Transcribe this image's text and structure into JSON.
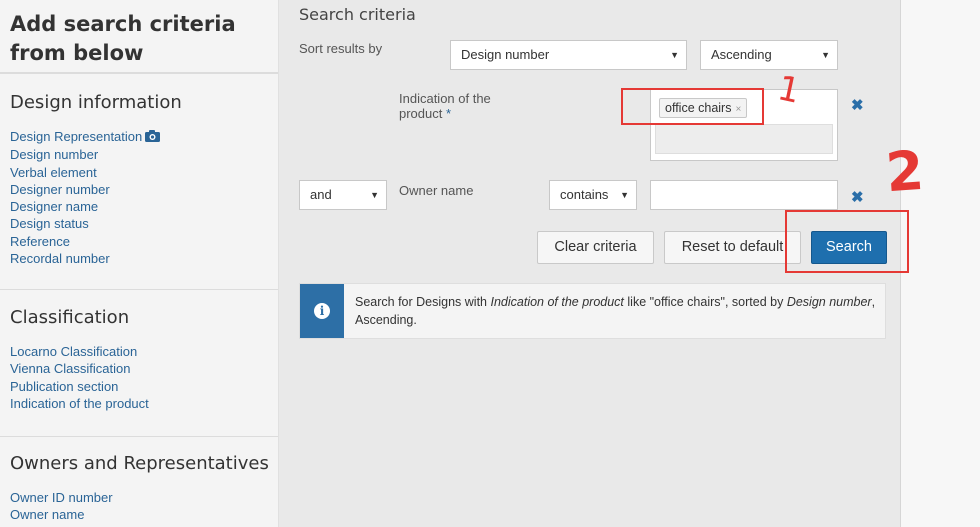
{
  "sidebar": {
    "title": "Add search criteria from below",
    "sections": [
      {
        "heading": "Design information",
        "links": [
          "Design Representation",
          "Design number",
          "Verbal element",
          "Designer number",
          "Designer name",
          "Design status",
          "Reference",
          "Recordal number"
        ]
      },
      {
        "heading": "Classification",
        "links": [
          "Locarno Classification",
          "Vienna Classification",
          "Publication section",
          "Indication of the product"
        ]
      },
      {
        "heading": "Owners and Representatives",
        "links": [
          "Owner ID number",
          "Owner name"
        ]
      }
    ]
  },
  "main": {
    "heading": "Search criteria",
    "sort_label": "Sort results by",
    "sort_field": "Design number",
    "sort_order": "Ascending",
    "criterion1": {
      "label": "Indication of the product",
      "required_mark": "*",
      "tag": "office chairs",
      "tag_remove": "×"
    },
    "criterion2": {
      "operator": "and",
      "label": "Owner name",
      "match": "contains",
      "value": ""
    },
    "remove_glyph": "✖",
    "buttons": {
      "clear": "Clear criteria",
      "reset": "Reset to default",
      "search": "Search"
    },
    "info": {
      "part1": "Search for Designs with ",
      "field": "Indication of the product",
      "part2": " like \"office chairs\", sorted by ",
      "sort_field": "Design number",
      "part3": ", Ascending."
    }
  },
  "annotations": {
    "label1": "1",
    "label2": "2",
    "color": "#e53935"
  },
  "colors": {
    "link": "#2a6496",
    "primary": "#1e6fae",
    "info_icon_bg": "#2d6fa6"
  }
}
